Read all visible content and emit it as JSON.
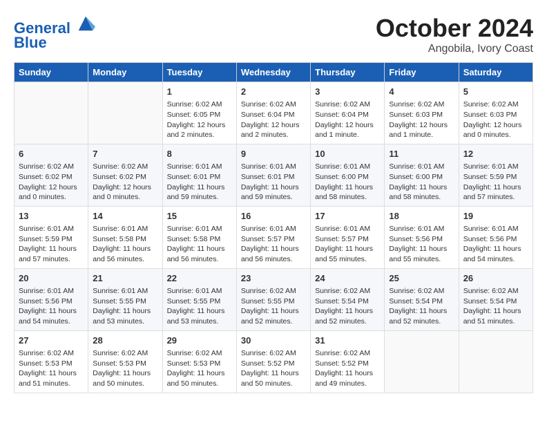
{
  "header": {
    "logo_line1": "General",
    "logo_line2": "Blue",
    "month": "October 2024",
    "location": "Angobila, Ivory Coast"
  },
  "weekdays": [
    "Sunday",
    "Monday",
    "Tuesday",
    "Wednesday",
    "Thursday",
    "Friday",
    "Saturday"
  ],
  "weeks": [
    [
      {
        "day": "",
        "info": ""
      },
      {
        "day": "",
        "info": ""
      },
      {
        "day": "1",
        "info": "Sunrise: 6:02 AM\nSunset: 6:05 PM\nDaylight: 12 hours and 2 minutes."
      },
      {
        "day": "2",
        "info": "Sunrise: 6:02 AM\nSunset: 6:04 PM\nDaylight: 12 hours and 2 minutes."
      },
      {
        "day": "3",
        "info": "Sunrise: 6:02 AM\nSunset: 6:04 PM\nDaylight: 12 hours and 1 minute."
      },
      {
        "day": "4",
        "info": "Sunrise: 6:02 AM\nSunset: 6:03 PM\nDaylight: 12 hours and 1 minute."
      },
      {
        "day": "5",
        "info": "Sunrise: 6:02 AM\nSunset: 6:03 PM\nDaylight: 12 hours and 0 minutes."
      }
    ],
    [
      {
        "day": "6",
        "info": "Sunrise: 6:02 AM\nSunset: 6:02 PM\nDaylight: 12 hours and 0 minutes."
      },
      {
        "day": "7",
        "info": "Sunrise: 6:02 AM\nSunset: 6:02 PM\nDaylight: 12 hours and 0 minutes."
      },
      {
        "day": "8",
        "info": "Sunrise: 6:01 AM\nSunset: 6:01 PM\nDaylight: 11 hours and 59 minutes."
      },
      {
        "day": "9",
        "info": "Sunrise: 6:01 AM\nSunset: 6:01 PM\nDaylight: 11 hours and 59 minutes."
      },
      {
        "day": "10",
        "info": "Sunrise: 6:01 AM\nSunset: 6:00 PM\nDaylight: 11 hours and 58 minutes."
      },
      {
        "day": "11",
        "info": "Sunrise: 6:01 AM\nSunset: 6:00 PM\nDaylight: 11 hours and 58 minutes."
      },
      {
        "day": "12",
        "info": "Sunrise: 6:01 AM\nSunset: 5:59 PM\nDaylight: 11 hours and 57 minutes."
      }
    ],
    [
      {
        "day": "13",
        "info": "Sunrise: 6:01 AM\nSunset: 5:59 PM\nDaylight: 11 hours and 57 minutes."
      },
      {
        "day": "14",
        "info": "Sunrise: 6:01 AM\nSunset: 5:58 PM\nDaylight: 11 hours and 56 minutes."
      },
      {
        "day": "15",
        "info": "Sunrise: 6:01 AM\nSunset: 5:58 PM\nDaylight: 11 hours and 56 minutes."
      },
      {
        "day": "16",
        "info": "Sunrise: 6:01 AM\nSunset: 5:57 PM\nDaylight: 11 hours and 56 minutes."
      },
      {
        "day": "17",
        "info": "Sunrise: 6:01 AM\nSunset: 5:57 PM\nDaylight: 11 hours and 55 minutes."
      },
      {
        "day": "18",
        "info": "Sunrise: 6:01 AM\nSunset: 5:56 PM\nDaylight: 11 hours and 55 minutes."
      },
      {
        "day": "19",
        "info": "Sunrise: 6:01 AM\nSunset: 5:56 PM\nDaylight: 11 hours and 54 minutes."
      }
    ],
    [
      {
        "day": "20",
        "info": "Sunrise: 6:01 AM\nSunset: 5:56 PM\nDaylight: 11 hours and 54 minutes."
      },
      {
        "day": "21",
        "info": "Sunrise: 6:01 AM\nSunset: 5:55 PM\nDaylight: 11 hours and 53 minutes."
      },
      {
        "day": "22",
        "info": "Sunrise: 6:01 AM\nSunset: 5:55 PM\nDaylight: 11 hours and 53 minutes."
      },
      {
        "day": "23",
        "info": "Sunrise: 6:02 AM\nSunset: 5:55 PM\nDaylight: 11 hours and 52 minutes."
      },
      {
        "day": "24",
        "info": "Sunrise: 6:02 AM\nSunset: 5:54 PM\nDaylight: 11 hours and 52 minutes."
      },
      {
        "day": "25",
        "info": "Sunrise: 6:02 AM\nSunset: 5:54 PM\nDaylight: 11 hours and 52 minutes."
      },
      {
        "day": "26",
        "info": "Sunrise: 6:02 AM\nSunset: 5:54 PM\nDaylight: 11 hours and 51 minutes."
      }
    ],
    [
      {
        "day": "27",
        "info": "Sunrise: 6:02 AM\nSunset: 5:53 PM\nDaylight: 11 hours and 51 minutes."
      },
      {
        "day": "28",
        "info": "Sunrise: 6:02 AM\nSunset: 5:53 PM\nDaylight: 11 hours and 50 minutes."
      },
      {
        "day": "29",
        "info": "Sunrise: 6:02 AM\nSunset: 5:53 PM\nDaylight: 11 hours and 50 minutes."
      },
      {
        "day": "30",
        "info": "Sunrise: 6:02 AM\nSunset: 5:52 PM\nDaylight: 11 hours and 50 minutes."
      },
      {
        "day": "31",
        "info": "Sunrise: 6:02 AM\nSunset: 5:52 PM\nDaylight: 11 hours and 49 minutes."
      },
      {
        "day": "",
        "info": ""
      },
      {
        "day": "",
        "info": ""
      }
    ]
  ]
}
